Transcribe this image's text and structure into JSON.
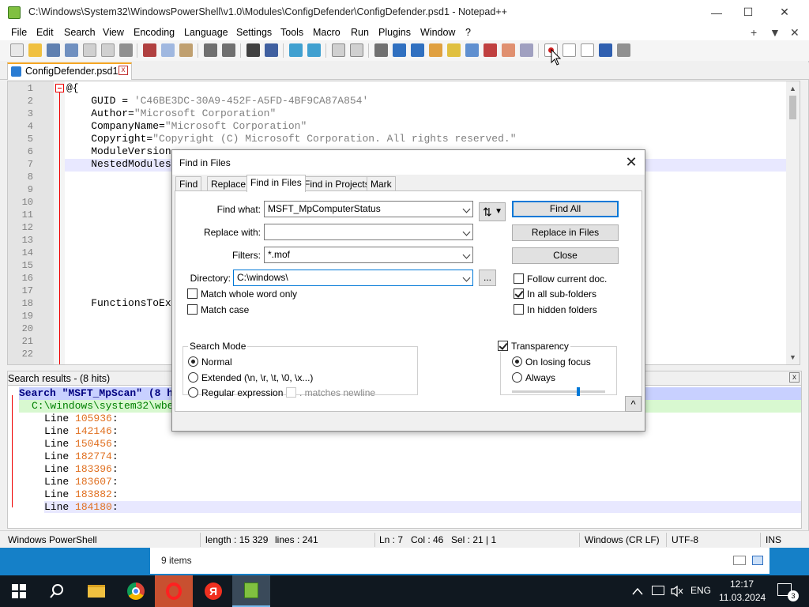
{
  "window": {
    "title": "C:\\Windows\\System32\\WindowsPowerShell\\v1.0\\Modules\\ConfigDefender\\ConfigDefender.psd1 - Notepad++",
    "minimize": "—",
    "maximize": "☐",
    "close": "✕"
  },
  "menu": {
    "items": [
      "File",
      "Edit",
      "Search",
      "View",
      "Encoding",
      "Language",
      "Settings",
      "Tools",
      "Macro",
      "Run",
      "Plugins",
      "Window",
      "?"
    ],
    "right": [
      "+",
      "▼",
      "✕"
    ]
  },
  "tab": {
    "label": "ConfigDefender.psd1",
    "close": "x"
  },
  "editor": {
    "line_numbers": [
      "1",
      "2",
      "3",
      "4",
      "5",
      "6",
      "7",
      "8",
      "9",
      "10",
      "11",
      "12",
      "13",
      "14",
      "15",
      "16",
      "17",
      "18",
      "19",
      "20",
      "21",
      "22"
    ],
    "lines": [
      {
        "plain": "@{",
        "str": ""
      },
      {
        "plain": "    GUID = ",
        "str": "'C46BE3DC-30A9-452F-A5FD-4BF9CA87A854'"
      },
      {
        "plain": "    Author=",
        "str": "\"Microsoft Corporation\""
      },
      {
        "plain": "    CompanyName=",
        "str": "\"Microsoft Corporation\""
      },
      {
        "plain": "    Copyright=",
        "str": "\"Copyright (C) Microsoft Corporation. All rights reserved.\""
      },
      {
        "plain": "    ModuleVersion",
        "str": ""
      },
      {
        "plain": "    NestedModules",
        "str": ""
      },
      {
        "plain": "",
        "str": ""
      },
      {
        "plain": "",
        "str": ""
      },
      {
        "plain": "",
        "str": ""
      },
      {
        "plain": "",
        "str": ""
      },
      {
        "plain": "",
        "str": ""
      },
      {
        "plain": "",
        "str": ""
      },
      {
        "plain": "",
        "str": ""
      },
      {
        "plain": "",
        "str": ""
      },
      {
        "plain": "",
        "str": ""
      },
      {
        "plain": "",
        "str": ""
      },
      {
        "plain": "    FunctionsToEx",
        "str": ""
      }
    ]
  },
  "results": {
    "header": "Search results - (8 hits)",
    "close": "x",
    "search_line": "Search \"MSFT_MpScan\" (8 h",
    "file_line": "C:\\windows\\system32\\wbe",
    "line_prefix": "Line ",
    "hits": [
      "105936",
      "142146",
      "150456",
      "182774",
      "183396",
      "183607",
      "183882",
      "184180"
    ]
  },
  "status": {
    "lang": "Windows PowerShell",
    "length": "length : 15 329",
    "lines": "lines : 241",
    "ln": "Ln : 7",
    "col": "Col : 46",
    "sel": "Sel : 21 | 1",
    "eol": "Windows (CR LF)",
    "enc": "UTF-8",
    "mode": "INS"
  },
  "explorer": {
    "items": "9 items"
  },
  "dialog": {
    "title": "Find in Files",
    "close": "✕",
    "tabs": [
      "Find",
      "Replace",
      "Find in Files",
      "Find in Projects",
      "Mark"
    ],
    "labels": {
      "find_what": "Find what:",
      "replace_with": "Replace with:",
      "filters": "Filters:",
      "directory": "Directory:"
    },
    "values": {
      "find_what": "MSFT_MpComputerStatus",
      "replace_with": "",
      "filters": "*.mof",
      "directory": "C:\\windows\\"
    },
    "buttons": {
      "find_all": "Find All",
      "replace_in_files": "Replace in Files",
      "close": "Close",
      "browse": "...",
      "swap": "⇅",
      "collapse": "^"
    },
    "checkboxes": {
      "match_whole_word": "Match whole word only",
      "match_case": "Match case",
      "follow_current_doc": "Follow current doc.",
      "in_all_subfolders": "In all sub-folders",
      "in_hidden_folders": "In hidden folders",
      "matches_newline": ". matches newline",
      "transparency": "Transparency"
    },
    "search_mode": {
      "title": "Search Mode",
      "normal": "Normal",
      "extended": "Extended (\\n, \\r, \\t, \\0, \\x...)",
      "regex": "Regular expression"
    },
    "transparency": {
      "on_losing_focus": "On losing focus",
      "always": "Always",
      "level": 0.72
    }
  },
  "taskbar": {
    "lang": "ENG",
    "time": "12:17",
    "date": "11.03.2024",
    "notif_count": "3"
  }
}
